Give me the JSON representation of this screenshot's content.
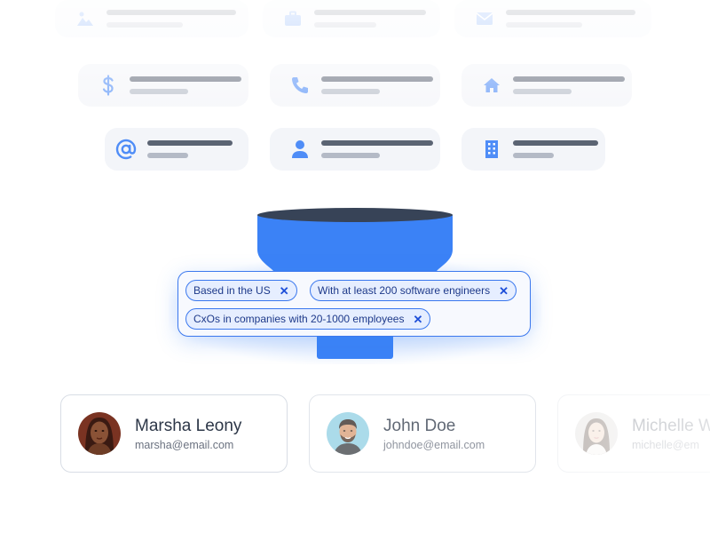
{
  "top_icons": [
    "image-icon",
    "briefcase-icon",
    "envelope-icon",
    "dollar-icon",
    "phone-icon",
    "home-icon",
    "at-sign-icon",
    "user-icon",
    "building-icon"
  ],
  "filters": {
    "chips": [
      {
        "label": "Based in the US"
      },
      {
        "label": "With at least 200 software engineers"
      },
      {
        "label": "CxOs in companies with 20-1000 employees"
      }
    ],
    "remove_symbol": "✕"
  },
  "people": [
    {
      "name": "Marsha Leony",
      "email": "marsha@email.com"
    },
    {
      "name": "John Doe",
      "email": "johndoe@email.com"
    },
    {
      "name": "Michelle W",
      "email": "michelle@em"
    }
  ],
  "colors": {
    "accent": "#3b82f6",
    "funnel_top": "#374357",
    "icon": "#4f8df7"
  }
}
